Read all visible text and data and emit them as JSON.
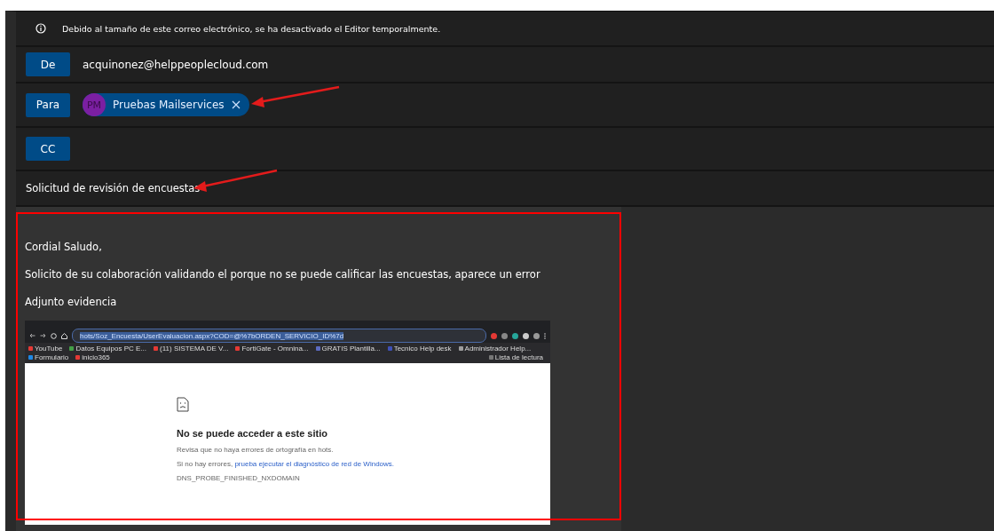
{
  "notice": {
    "text": "Debido al tamaño de este correo electrónico, se ha desactivado el Editor temporalmente."
  },
  "fields": [
    {
      "kind": "text",
      "label": "De",
      "value": "acquinonez@helppeoplecloud.com"
    },
    {
      "kind": "recipients",
      "label": "Para",
      "recipients": [
        {
          "initials": "PM",
          "name": "Pruebas Mailservices",
          "color": "#7b1fa2"
        }
      ]
    },
    {
      "kind": "empty",
      "label": "CC"
    }
  ],
  "subject": "Solicitud de revisión de encuestas",
  "body": {
    "paragraphs": [
      "Cordial Saludo,",
      "Solicito de su colaboración validando el porque no se puede calificar las encuestas, aparece un error",
      "Adjunto evidencia"
    ],
    "screenshot": {
      "url": "hots/Soz_Encuesta/UserEvaluacion.aspx?COD=@%7bORDEN_SERVICIO_ID%7d",
      "bookmarks": [
        "YouTube",
        "Datos Equipos PC E...",
        "(11) SISTEMA DE V...",
        "FortiGate - Omnina...",
        "GRATIS Plantilla...",
        "Tecnico Help desk",
        "Administrador Help...",
        "Formulario",
        "inicio365"
      ],
      "reading_list": "Lista de lectura",
      "error_title": "No se puede acceder a este sitio",
      "hint": "Revisa que no haya errores de ortografía en hots.",
      "suggestion_prefix": "Si no hay errores,",
      "suggestion_link": "prueba ejecutar el diagnóstico de red de Windows.",
      "error_code": "DNS_PROBE_FINISHED_NXDOMAIN"
    }
  }
}
